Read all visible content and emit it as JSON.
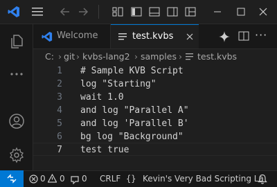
{
  "tabs": {
    "welcome": "Welcome",
    "file": "test.kvbs"
  },
  "breadcrumb": [
    "C:",
    "git",
    "kvbs-lang2",
    "samples",
    "test.kvbs"
  ],
  "editor": {
    "lines": [
      {
        "num": "1",
        "text": "# Sample KVB Script"
      },
      {
        "num": "2",
        "text": "log \"Starting\""
      },
      {
        "num": "3",
        "text": "wait 1.0"
      },
      {
        "num": "4",
        "text": "and log \"Parallel A\""
      },
      {
        "num": "5",
        "text": "and log 'Parallel B'"
      },
      {
        "num": "6",
        "text": "bg log \"Background\""
      },
      {
        "num": "7",
        "text": "test true"
      }
    ],
    "active_line": 7
  },
  "status": {
    "errors": "0",
    "warnings": "0",
    "ports": "0",
    "eol": "CRLF",
    "language": "Kevin's Very Bad Scripting La"
  },
  "colors": {
    "accent": "#0078d4",
    "vscode_blue": "#2f80ed"
  },
  "icons": [
    "vscode-logo-icon",
    "menu-icon",
    "back-arrow-icon",
    "forward-arrow-icon",
    "layout-icon",
    "sidebar-toggle-icon",
    "panel-toggle-icon",
    "secondary-sidebar-icon",
    "layout-customize-icon",
    "minimize-icon",
    "maximize-icon",
    "close-icon",
    "explorer-icon",
    "more-icon",
    "account-icon",
    "settings-gear-icon",
    "copilot-sparkle-icon",
    "split-editor-icon",
    "remote-icon",
    "error-icon",
    "warning-icon",
    "ports-icon",
    "braces-icon",
    "bell-icon"
  ]
}
